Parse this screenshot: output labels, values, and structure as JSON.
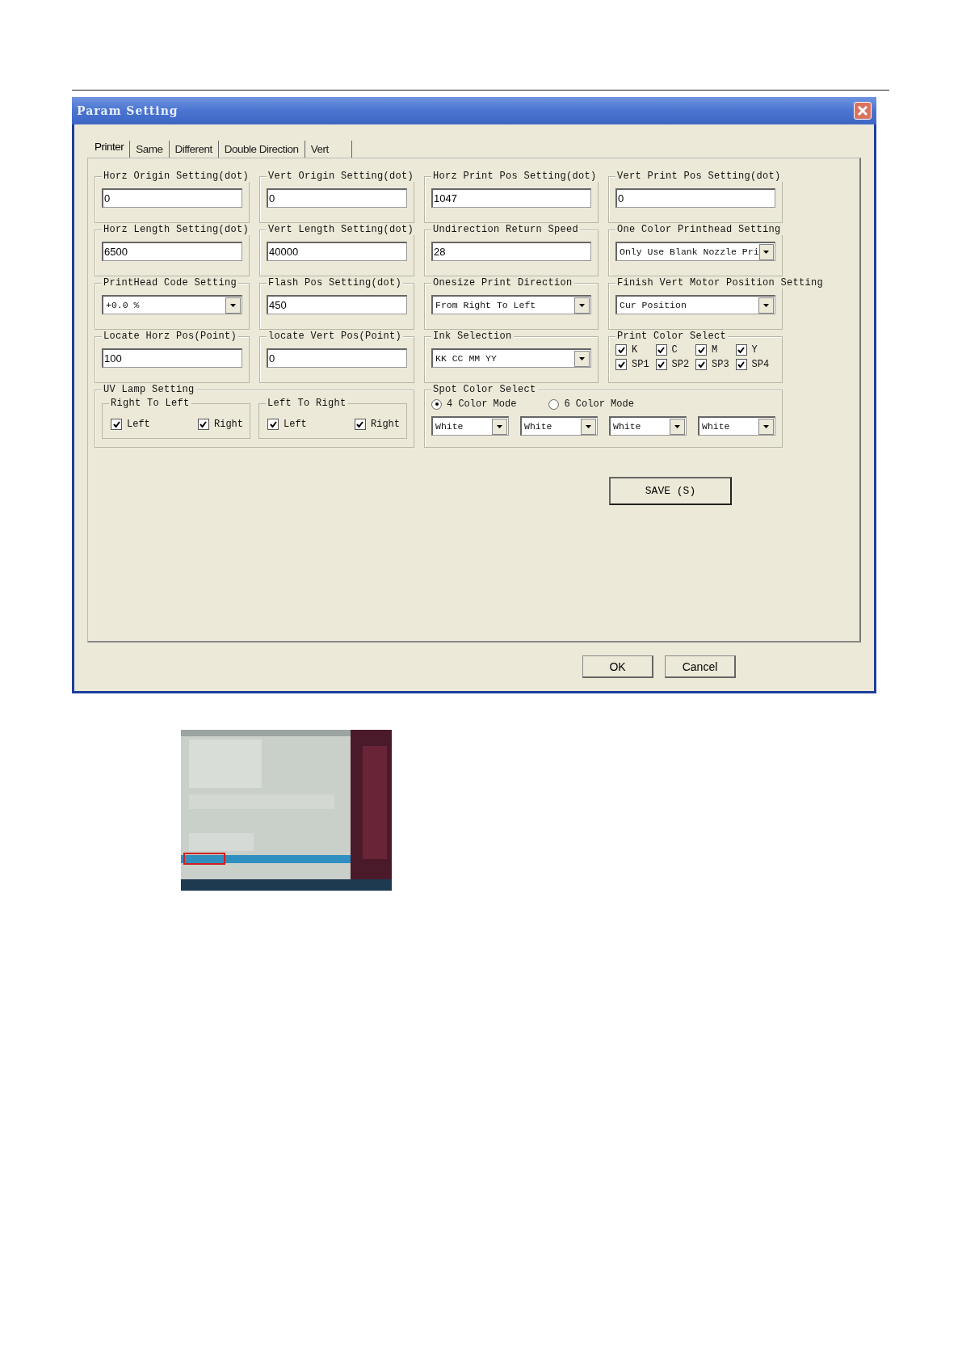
{
  "window": {
    "title": "Param Setting"
  },
  "tabs": [
    {
      "label": "Printer",
      "selected": true
    },
    {
      "label": "Same",
      "selected": false
    },
    {
      "label": "Different",
      "selected": false
    },
    {
      "label": "Double Direction",
      "selected": false
    },
    {
      "label": "Vert",
      "selected": false
    }
  ],
  "groups": [
    {
      "kind": "text",
      "title": "Horz Origin Setting(dot)",
      "value": "0"
    },
    {
      "kind": "text",
      "title": "Vert Origin Setting(dot)",
      "value": "0"
    },
    {
      "kind": "text",
      "title": "Horz Print Pos Setting(dot)",
      "value": "1047"
    },
    {
      "kind": "text",
      "title": "Vert Print Pos Setting(dot)",
      "value": "0"
    },
    {
      "kind": "text",
      "title": "Horz Length Setting(dot)",
      "value": "6500"
    },
    {
      "kind": "text",
      "title": "Vert Length Setting(dot)",
      "value": "40000"
    },
    {
      "kind": "text",
      "title": "Undirection Return Speed",
      "value": "28"
    },
    {
      "kind": "select",
      "title": "One Color Printhead Setting",
      "value": "Only Use Blank Nozzle Pri"
    },
    {
      "kind": "select",
      "title": "PrintHead Code Setting",
      "value": "+0.0 %"
    },
    {
      "kind": "text",
      "title": "Flash Pos Setting(dot)",
      "value": "450"
    },
    {
      "kind": "select",
      "title": "Onesize Print Direction",
      "value": "From Right To Left"
    },
    {
      "kind": "select",
      "title": "Finish Vert Motor Position Setting",
      "value": "Cur Position"
    },
    {
      "kind": "text",
      "title": "Locate Horz Pos(Point)",
      "value": "100"
    },
    {
      "kind": "text",
      "title": "locate Vert Pos(Point)",
      "value": "0"
    },
    {
      "kind": "select",
      "title": "Ink Selection",
      "value": "KK CC MM YY"
    },
    {
      "kind": "checks",
      "title": "Print Color Select",
      "items": [
        {
          "label": "K",
          "checked": true
        },
        {
          "label": "C",
          "checked": true
        },
        {
          "label": "M",
          "checked": true
        },
        {
          "label": "Y",
          "checked": true
        },
        {
          "label": "SP1",
          "checked": true
        },
        {
          "label": "SP2",
          "checked": true
        },
        {
          "label": "SP3",
          "checked": true
        },
        {
          "label": "SP4",
          "checked": true
        }
      ]
    },
    {
      "kind": "uv",
      "title": "UV Lamp Setting",
      "subgroups": [
        {
          "title": "Right To Left",
          "items": [
            {
              "label": "Left",
              "checked": true
            },
            {
              "label": "Right",
              "checked": true
            }
          ]
        },
        {
          "title": "Left To Right",
          "items": [
            {
              "label": "Left",
              "checked": true
            },
            {
              "label": "Right",
              "checked": true
            }
          ]
        }
      ]
    },
    {
      "kind": "spot",
      "title": "Spot Color Select",
      "modes": [
        {
          "label": "4 Color Mode",
          "selected": true
        },
        {
          "label": "6 Color Mode",
          "selected": false
        }
      ],
      "selects": [
        "White",
        "White",
        "White",
        "White"
      ]
    }
  ],
  "save_button": "SAVE (S)",
  "buttons": [
    "OK",
    "Cancel"
  ]
}
